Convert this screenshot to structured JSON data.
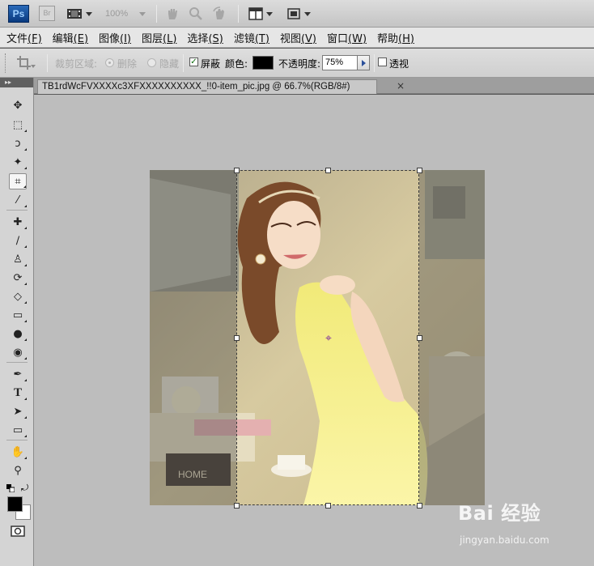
{
  "app": {
    "logo": "Ps",
    "bridge_logo": "Br",
    "zoom_level": "100%"
  },
  "menubar": {
    "items": [
      {
        "label": "文件",
        "key": "(F)"
      },
      {
        "label": "编辑",
        "key": "(E)"
      },
      {
        "label": "图像",
        "key": "(I)"
      },
      {
        "label": "图层",
        "key": "(L)"
      },
      {
        "label": "选择",
        "key": "(S)"
      },
      {
        "label": "滤镜",
        "key": "(T)"
      },
      {
        "label": "视图",
        "key": "(V)"
      },
      {
        "label": "窗口",
        "key": "(W)"
      },
      {
        "label": "帮助",
        "key": "(H)"
      }
    ]
  },
  "options": {
    "crop_area_label": "裁剪区域:",
    "delete_label": "删除",
    "hide_label": "隐藏",
    "shield_label": "屏蔽",
    "shield_checked": true,
    "color_label": "颜色:",
    "shield_color": "#000000",
    "opacity_label": "不透明度:",
    "opacity_value": "75%",
    "perspective_label": "透视",
    "perspective_checked": false
  },
  "document": {
    "tab_title": "TB1rdWcFVXXXXc3XFXXXXXXXXXX_!!0-item_pic.jpg @ 66.7%(RGB/8#)",
    "close_glyph": "×"
  },
  "toolbox": {
    "header": "▸▸",
    "tools": [
      {
        "name": "move-tool",
        "icon": "✥"
      },
      {
        "name": "marquee-tool",
        "icon": "⬚"
      },
      {
        "name": "lasso-tool",
        "icon": "ↄ"
      },
      {
        "name": "magic-wand-tool",
        "icon": "✦"
      },
      {
        "name": "crop-tool",
        "icon": "⌗"
      },
      {
        "name": "eyedropper-tool",
        "icon": "⁄"
      },
      {
        "name": "healing-brush-tool",
        "icon": "✚"
      },
      {
        "name": "brush-tool",
        "icon": "∕"
      },
      {
        "name": "clone-stamp-tool",
        "icon": "♙"
      },
      {
        "name": "history-brush-tool",
        "icon": "⟳"
      },
      {
        "name": "eraser-tool",
        "icon": "◇"
      },
      {
        "name": "gradient-tool",
        "icon": "▭"
      },
      {
        "name": "blur-tool",
        "icon": "●"
      },
      {
        "name": "dodge-tool",
        "icon": "◉"
      },
      {
        "name": "pen-tool",
        "icon": "✒"
      },
      {
        "name": "type-tool",
        "icon": "T"
      },
      {
        "name": "path-selection-tool",
        "icon": "➤"
      },
      {
        "name": "shape-tool",
        "icon": "▭"
      },
      {
        "name": "hand-tool",
        "icon": "✋"
      },
      {
        "name": "zoom-tool",
        "icon": "⚲"
      }
    ],
    "foreground_color": "#000000",
    "background_color": "#ffffff"
  },
  "canvas": {
    "background_color": "#bdbdbd"
  },
  "watermark": {
    "brand": "Bai 经验",
    "url": "jingyan.baidu.com"
  }
}
